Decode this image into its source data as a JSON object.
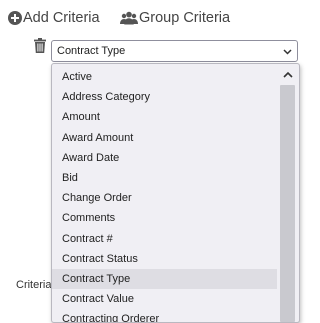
{
  "toolbar": {
    "add_criteria_label": "Add Criteria",
    "group_criteria_label": "Group Criteria"
  },
  "criteria": {
    "label": "Criteria",
    "select": {
      "selected_value": "Contract Type",
      "options": [
        "Active",
        "Address Category",
        "Amount",
        "Award Amount",
        "Award Date",
        "Bid",
        "Change Order",
        "Comments",
        "Contract #",
        "Contract Status",
        "Contract Type",
        "Contract Value",
        "Contracting Orderer"
      ],
      "highlighted_option": "Contract Type"
    }
  },
  "colors": {
    "dropdown_background": "#f0eff4",
    "hover_background": "#dedde3",
    "scrollbar_thumb": "#c9c9cf",
    "icon": "#555555"
  },
  "icons": {
    "add": "plus-circle-icon",
    "group": "users-icon",
    "delete": "trash-icon",
    "select_arrow": "chevron-down-icon",
    "scroll_up": "chevron-up-icon"
  }
}
